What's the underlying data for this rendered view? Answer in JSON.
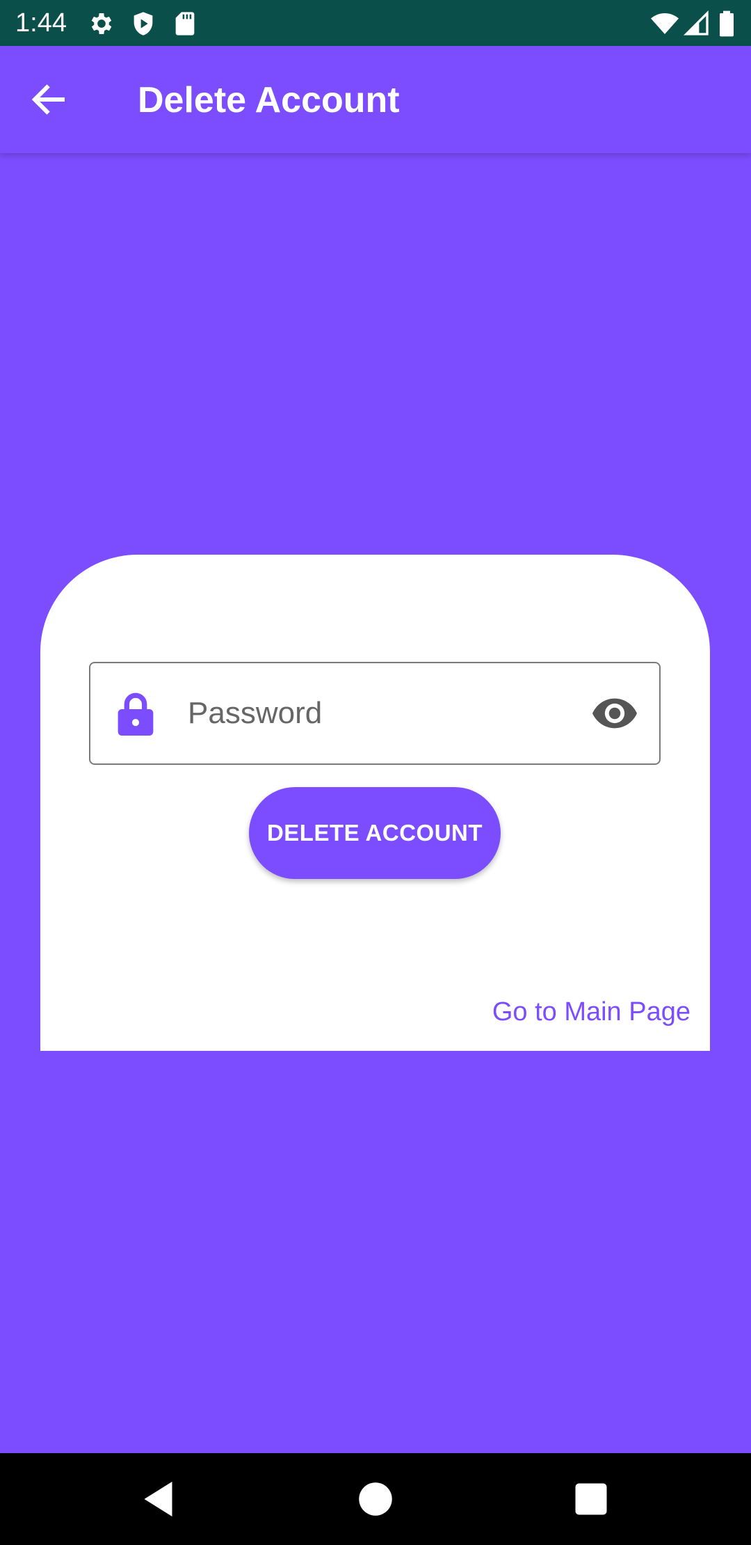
{
  "status_bar": {
    "time": "1:44",
    "icons": [
      "gear-icon",
      "shield-play-icon",
      "sd-card-icon",
      "wifi-icon",
      "signal-icon",
      "battery-icon"
    ],
    "background_color": "#0B4F4A"
  },
  "app_bar": {
    "title": "Delete Account",
    "back_icon": "arrow-back-icon"
  },
  "card": {
    "password_field": {
      "placeholder": "Password",
      "value": "",
      "leading_icon": "lock-icon",
      "trailing_icon": "eye-icon"
    },
    "delete_button_label": "DELETE ACCOUNT",
    "main_page_link_label": "Go to Main Page"
  },
  "nav_bar": {
    "buttons": [
      "back-triangle-icon",
      "home-circle-icon",
      "recents-square-icon"
    ]
  },
  "colors": {
    "accent": "#7C4DFF",
    "card_background": "#FFFFFF",
    "nav_background": "#000000"
  }
}
